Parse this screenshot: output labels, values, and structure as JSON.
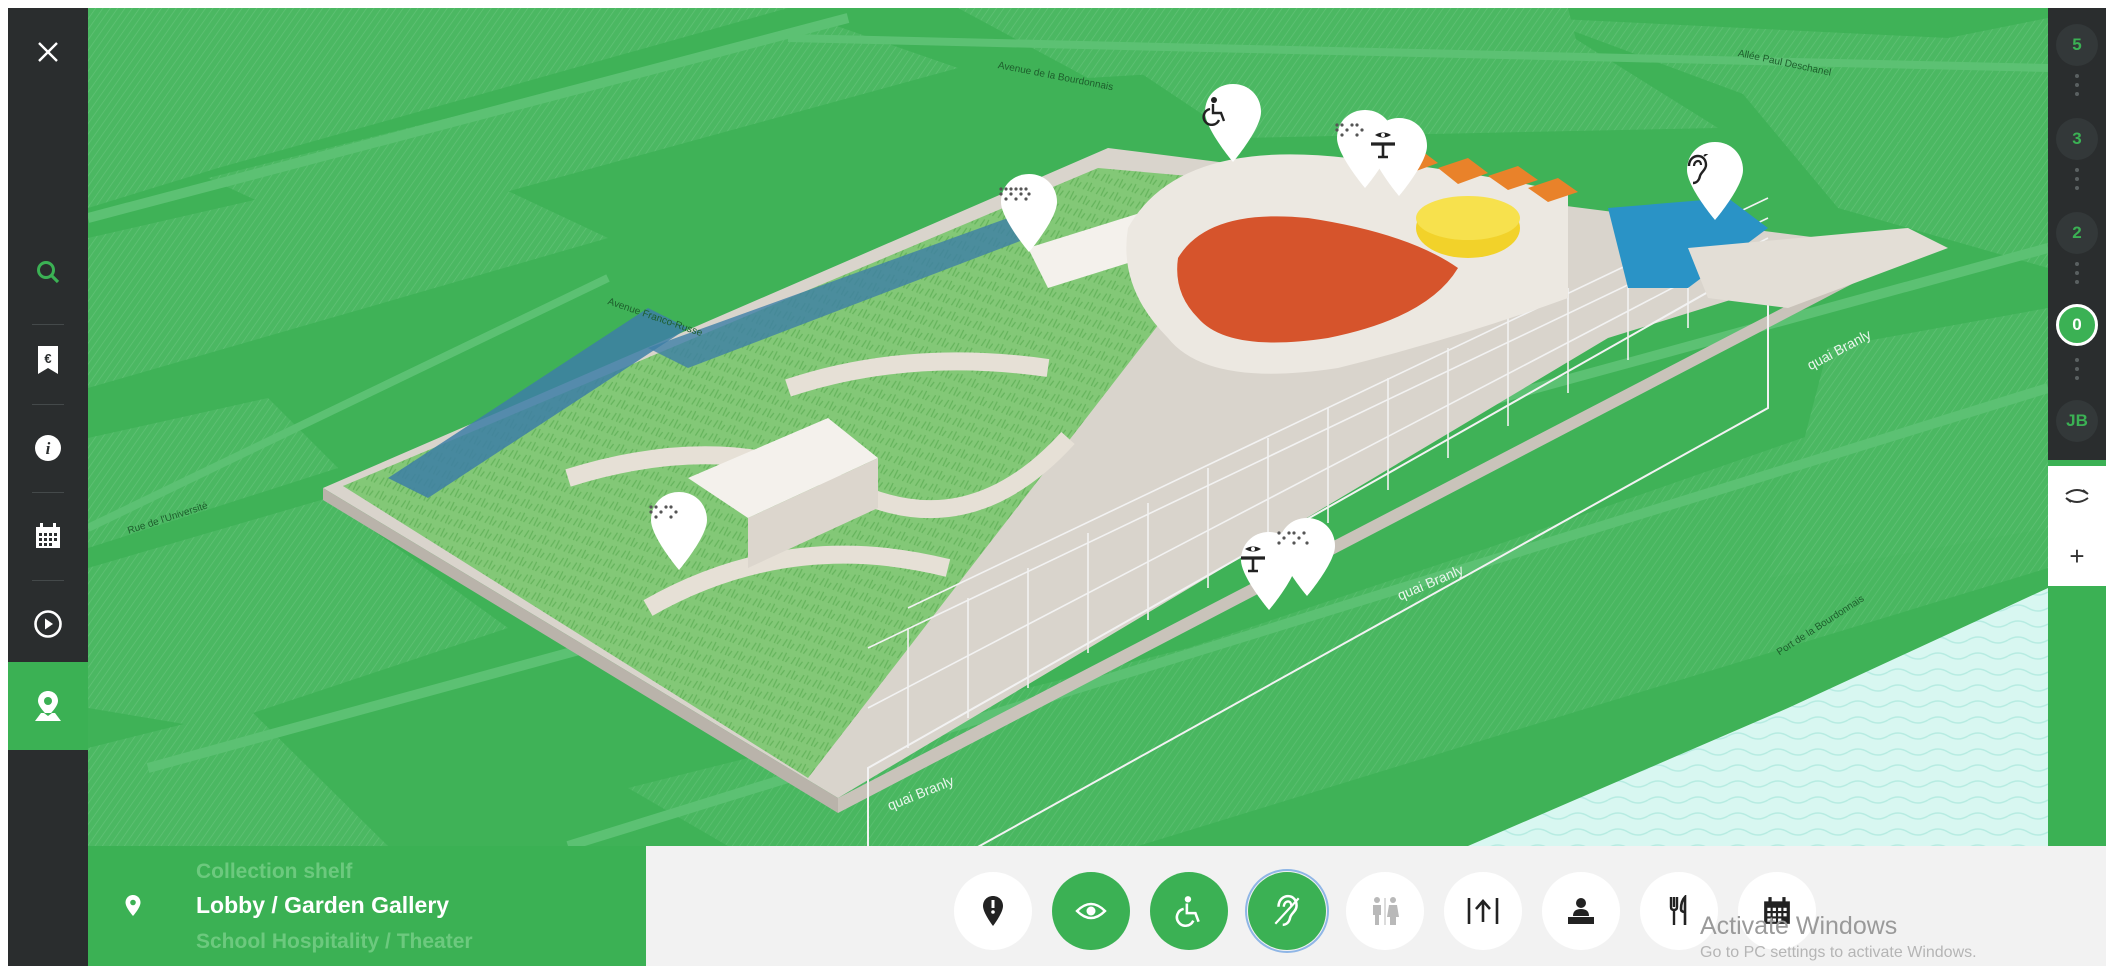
{
  "sidebar": {
    "items": [
      {
        "icon": "close-icon"
      },
      {
        "icon": "search-icon"
      },
      {
        "icon": "ticket-euro-icon",
        "glyph": "€"
      },
      {
        "icon": "info-icon",
        "glyph": "i"
      },
      {
        "icon": "calendar-icon"
      },
      {
        "icon": "play-icon"
      },
      {
        "icon": "map-pin-icon",
        "active": true
      }
    ]
  },
  "map": {
    "streets": [
      "Avenue de la Bourdonnais",
      "Allée Paul Deschanel",
      "Avenue Franco-Russe",
      "Rue de l'Université",
      "quai Branly",
      "quai Branly",
      "quai Branly",
      "Port de la Bourdonnais"
    ],
    "pins": [
      {
        "icon": "wheelchair-icon"
      },
      {
        "icon": "braille-icon"
      },
      {
        "icon": "braille-icon"
      },
      {
        "icon": "eye-table-icon"
      },
      {
        "icon": "ear-icon"
      },
      {
        "icon": "braille-icon"
      },
      {
        "icon": "eye-table-icon"
      },
      {
        "icon": "braille-icon"
      }
    ],
    "colors": {
      "map_green": "#3fb257",
      "river": "#c7f2ea",
      "building": "#eeeae3",
      "theater": "#d6542c",
      "shop": "#f2d22a",
      "hearing_area": "#2a93c6",
      "offices": "#e9822a"
    }
  },
  "floors": {
    "levels": [
      "5",
      "3",
      "2",
      "0",
      "JB"
    ],
    "active": "0",
    "tools": [
      {
        "icon": "rotate-icon"
      },
      {
        "icon": "zoom-in-icon",
        "glyph": "+"
      }
    ]
  },
  "levels_panel": {
    "above": "Collection shelf",
    "current": "Lobby / Garden Gallery",
    "below": "School Hospitality / Theater"
  },
  "toolbar": {
    "buttons": [
      {
        "icon": "point-of-interest-icon",
        "on": false
      },
      {
        "icon": "visual-impairment-icon",
        "on": true
      },
      {
        "icon": "wheelchair-icon",
        "on": true
      },
      {
        "icon": "hearing-impairment-icon",
        "on": true,
        "selected": true
      },
      {
        "icon": "toilets-icon",
        "on": false
      },
      {
        "icon": "elevator-icon",
        "on": false
      },
      {
        "icon": "reception-desk-icon",
        "on": false
      },
      {
        "icon": "restaurant-icon",
        "on": false
      },
      {
        "icon": "calendar-grid-icon",
        "on": false
      }
    ]
  },
  "watermark": {
    "title": "Activate Windows",
    "subtitle": "Go to PC settings to activate Windows."
  }
}
